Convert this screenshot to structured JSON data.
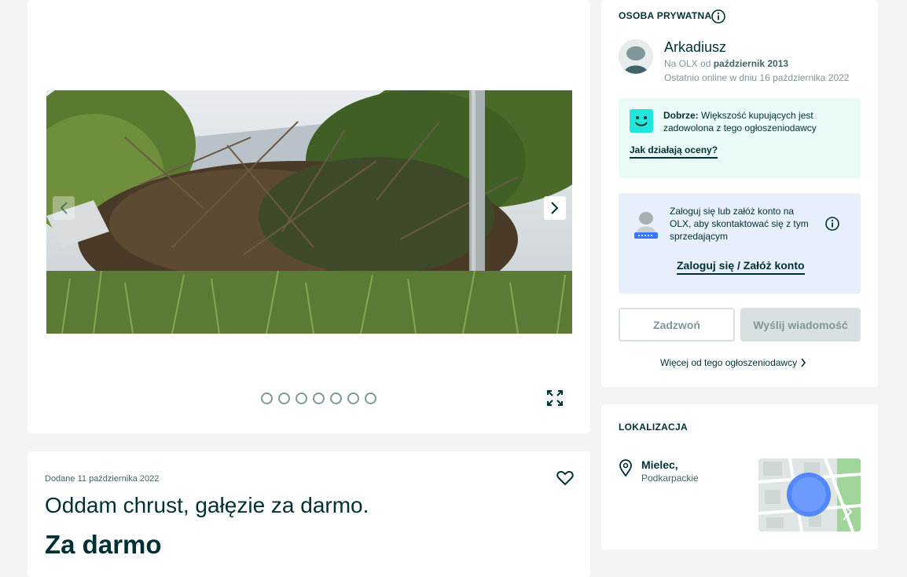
{
  "gallery": {
    "photo_alt": "",
    "dot_count": 7
  },
  "ad": {
    "added": "Dodane 11 października 2022",
    "title": "Oddam chrust, gałęzie za darmo.",
    "price": "Za darmo"
  },
  "seller": {
    "section_label": "OSOBA PRYWATNA",
    "name": "Arkadiusz",
    "since_prefix": "Na OLX od ",
    "since_value": "październik 2013",
    "online": "Ostatnio online w dniu 16 października 2022",
    "rating_bold": "Dobrze:",
    "rating_text": " Większość kupujących jest zadowolona z tego ogłoszeniodawcy",
    "rating_link": "Jak działają oceny?",
    "login_text": "Zaloguj się lub załóż konto na OLX, aby skontaktować się z tym sprzedającym",
    "login_link": "Zaloguj się / Załóż konto",
    "call_button": "Zadzwoń",
    "message_button": "Wyślij wiadomość",
    "more_link": "Więcej od tego ogłoszeniodawcy"
  },
  "location": {
    "section_label": "LOKALIZACJA",
    "city": "Mielec,",
    "region": "Podkarpackie"
  },
  "colors": {
    "primary": "#002f34",
    "rating_bg": "#eafaf7",
    "login_bg": "#e7eefc",
    "smile": "#23e5db",
    "map_marker": "#3a77ff"
  },
  "icons": [
    "info-icon",
    "chevron-left-icon",
    "chevron-right-icon",
    "fullscreen-icon",
    "heart-icon",
    "map-pin-icon",
    "smiley-icon"
  ]
}
